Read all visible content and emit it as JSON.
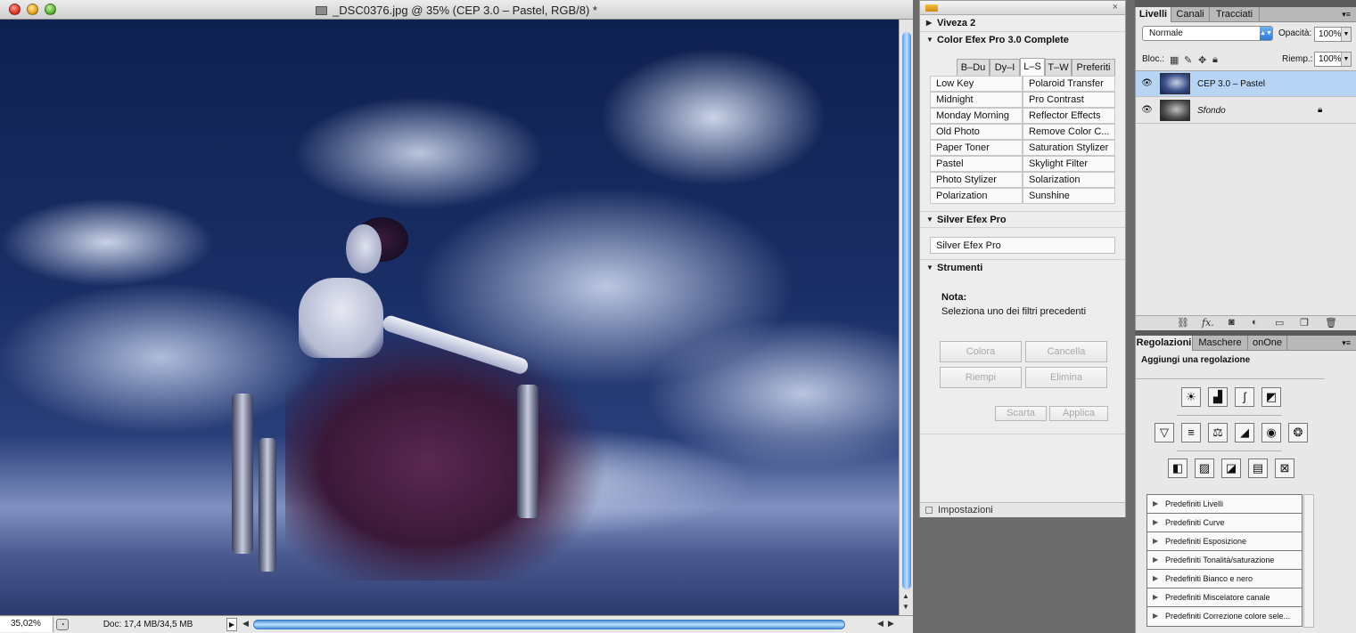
{
  "document": {
    "title": "_DSC0376.jpg @ 35% (CEP 3.0 – Pastel, RGB/8) *",
    "zoom": "35,02%",
    "doc_size": "Doc: 17,4 MB/34,5 MB"
  },
  "nik": {
    "sections": {
      "viveza": "Viveza 2",
      "color_efex": "Color Efex Pro 3.0 Complete",
      "silver_efex": "Silver Efex Pro",
      "strumenti": "Strumenti"
    },
    "tabs": [
      "B–Du",
      "Dy–I",
      "L–S",
      "T–W",
      "Preferiti"
    ],
    "active_tab": "L–S",
    "filters_left": [
      "Low Key",
      "Midnight",
      "Monday Morning",
      "Old Photo",
      "Paper Toner",
      "Pastel",
      "Photo Stylizer",
      "Polarization"
    ],
    "filters_right": [
      "Polaroid Transfer",
      "Pro Contrast",
      "Reflector Effects",
      "Remove Color C...",
      "Saturation Stylizer",
      "Skylight Filter",
      "Solarization",
      "Sunshine"
    ],
    "silver_button": "Silver Efex Pro",
    "nota_label": "Nota:",
    "nota_text": "Seleziona uno dei filtri precedenti",
    "buttons": {
      "colora": "Colora",
      "cancella": "Cancella",
      "riempi": "Riempi",
      "elimina": "Elimina",
      "scarta": "Scarta",
      "applica": "Applica"
    },
    "footer": "Impostazioni"
  },
  "layers_panel": {
    "tabs": [
      "Livelli",
      "Canali",
      "Tracciati"
    ],
    "active_tab": "Livelli",
    "blend_mode": "Normale",
    "opacity_label": "Opacità:",
    "opacity": "100%",
    "lock_label": "Bloc.:",
    "fill_label": "Riemp.:",
    "fill": "100%",
    "layers": [
      {
        "name": "CEP 3.0 – Pastel",
        "selected": true,
        "locked": false
      },
      {
        "name": "Sfondo",
        "selected": false,
        "locked": true
      }
    ]
  },
  "adjustments_panel": {
    "tabs": [
      "Regolazioni",
      "Maschere",
      "onOne"
    ],
    "active_tab": "Regolazioni",
    "title": "Aggiungi una regolazione",
    "presets": [
      "Predefiniti Livelli",
      "Predefiniti Curve",
      "Predefiniti Esposizione",
      "Predefiniti Tonalità/saturazione",
      "Predefiniti Bianco e nero",
      "Predefiniti Miscelatore canale",
      "Predefiniti Correzione colore sele..."
    ]
  },
  "colors": {
    "selection_blue": "#b8d4f4",
    "scroll_blue": "#4a90dc"
  }
}
